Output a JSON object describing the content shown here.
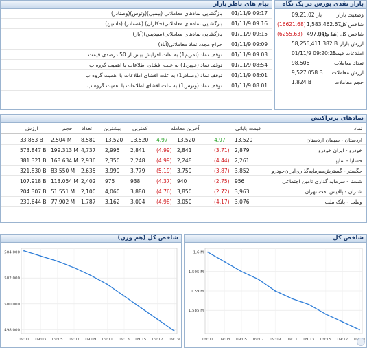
{
  "market": {
    "title": "بازار نقدی بورس در یک نگاه",
    "rows": [
      {
        "label": "وضعیت بازار",
        "value": "باز 09:21:02",
        "change": ""
      },
      {
        "label": "شاخص کل",
        "value": "1,583,462.67",
        "change": "(16621.68)"
      },
      {
        "label": "شاخص کل (هم وزن)",
        "value": "497,945.72",
        "change": "(6255.63)"
      },
      {
        "label": "ارزش بازار",
        "value": "58,256,411.382 B",
        "change": ""
      },
      {
        "label": "اطلاعات قیمت",
        "value": "01/11/9 09:20:25",
        "change": ""
      },
      {
        "label": "تعداد معاملات",
        "value": "98,506",
        "change": ""
      },
      {
        "label": "ارزش معاملات",
        "value": "9,527.058 B",
        "change": ""
      },
      {
        "label": "حجم معاملات",
        "value": "1.824 B",
        "change": ""
      }
    ]
  },
  "messages": {
    "title": "پیام های ناظر بازار",
    "rows": [
      {
        "time": "01/11/9 09:17",
        "text": "بازگشایی نمادهای معاملاتی (بیمپی)(وتوس)(وصنادر)"
      },
      {
        "time": "01/11/9 09:16",
        "text": "بازگشایی نمادهای معاملاتی(حکاران) (غصنادر) (داسین)"
      },
      {
        "time": "01/11/9 09:15",
        "text": "بازگشایی نمادهای معاملاتی(سیدیس)(آبار)"
      },
      {
        "time": "01/11/9 09:09",
        "text": "حراج مجدد نماد معاملاتی(آباد)"
      },
      {
        "time": "01/11/9 09:03",
        "text": "توقف نماد (ثمریم1) به علت افزایش بیش از 50 درصدی قیمت"
      },
      {
        "time": "01/11/9 08:54",
        "text": "توقف نماد (خپهن1) به علت افشای اطلاعات با اهمیت گروه ب"
      },
      {
        "time": "01/11/9 08:01",
        "text": "توقف نماد (وصنادر1) به علت افشای اطلاعات با اهمیت گروه ب"
      },
      {
        "time": "01/11/9 08:01",
        "text": "توقف نماد (وتوس1) به علت افشای اطلاعات با اهمیت گروه ب"
      }
    ]
  },
  "symbols": {
    "title": "نمادهای پرتراکنش",
    "columns": {
      "name": "نماد",
      "last_price": "قیمت پایانی",
      "last_trade": "آخرین معامله",
      "min": "کمترین",
      "max": "بیشترین",
      "count": "تعداد",
      "volume": "حجم",
      "value": "ارزش"
    },
    "rows": [
      {
        "name": "اردستان - سیمان اردستان",
        "last": "13,520",
        "last_chg": "4.97",
        "trade": "13,520",
        "trade_chg": "4.97",
        "min": "13,520",
        "max": "13,520",
        "count": "8,580",
        "volume": "2.504 M",
        "value": "33.853 B",
        "dir": "pos"
      },
      {
        "name": "خودرو - ایران خودرو",
        "last": "2,879",
        "last_chg": "(3.71)",
        "trade": "2,841",
        "trade_chg": "(4.99)",
        "min": "2,841",
        "max": "2,995",
        "count": "4,737",
        "volume": "199.313 M",
        "value": "573.847 B",
        "dir": "neg"
      },
      {
        "name": "خسایا - سایپا",
        "last": "2,261",
        "last_chg": "(4.44)",
        "trade": "2,248",
        "trade_chg": "(4.99)",
        "min": "2,248",
        "max": "2,350",
        "count": "2,936",
        "volume": "168.634 M",
        "value": "381.321 B",
        "dir": "neg"
      },
      {
        "name": "حگستر - گسترش‌سرمایه‌گذاری‌ایران‌خودرو",
        "last": "3,852",
        "last_chg": "(3.87)",
        "trade": "3,759",
        "trade_chg": "(5.19)",
        "min": "3,779",
        "max": "3,999",
        "count": "2,635",
        "volume": "83.550 M",
        "value": "321.830 B",
        "dir": "neg"
      },
      {
        "name": "شستا - سرمایه گذاری تامین اجتماعی",
        "last": "956",
        "last_chg": "(2.75)",
        "trade": "940",
        "trade_chg": "(4.37)",
        "min": "938",
        "max": "975",
        "count": "2,402",
        "volume": "113.054 M",
        "value": "107.918 B",
        "dir": "neg"
      },
      {
        "name": "شتران - پالایش نفت تهران",
        "last": "3,963",
        "last_chg": "(2.72)",
        "trade": "3,850",
        "trade_chg": "(4.76)",
        "min": "3,880",
        "max": "4,060",
        "count": "2,100",
        "volume": "51.551 M",
        "value": "204.307 B",
        "dir": "neg"
      },
      {
        "name": "وملت - بانک ملت",
        "last": "3,076",
        "last_chg": "(4.17)",
        "trade": "3,050",
        "trade_chg": "(4.98)",
        "min": "3,004",
        "max": "3,162",
        "count": "1,787",
        "volume": "77.902 M",
        "value": "239.644 B",
        "dir": "neg"
      }
    ]
  },
  "chart_data": [
    {
      "type": "line",
      "title": "شاخص کل",
      "x": [
        "09:01",
        "09:03",
        "09:05",
        "09:07",
        "09:09",
        "09:11",
        "09:13",
        "09:15",
        "09:17",
        "09:19"
      ],
      "series": [
        {
          "values": [
            1600000,
            1597500,
            1595000,
            1593000,
            1590000,
            1588000,
            1586500,
            1584000,
            1582000,
            1580000
          ]
        }
      ],
      "yticks": [
        "1.6 M",
        "1.595 M",
        "1.59 M",
        "1.585 M"
      ],
      "ylim": [
        1579000,
        1601000
      ],
      "color": "#2f7ed8"
    },
    {
      "type": "line",
      "title": "شاخص کل (هم وزن)",
      "x": [
        "09:01",
        "09:03",
        "09:05",
        "09:07",
        "09:09",
        "09:11",
        "09:13",
        "09:15",
        "09:17",
        "09:19"
      ],
      "series": [
        {
          "values": [
            504100,
            503700,
            503300,
            502800,
            502200,
            501500,
            500600,
            499700,
            498800,
            497900
          ]
        }
      ],
      "yticks": [
        "504,000",
        "502,000",
        "500,000",
        "498,000"
      ],
      "ylim": [
        497700,
        504300
      ],
      "color": "#2f7ed8"
    }
  ]
}
